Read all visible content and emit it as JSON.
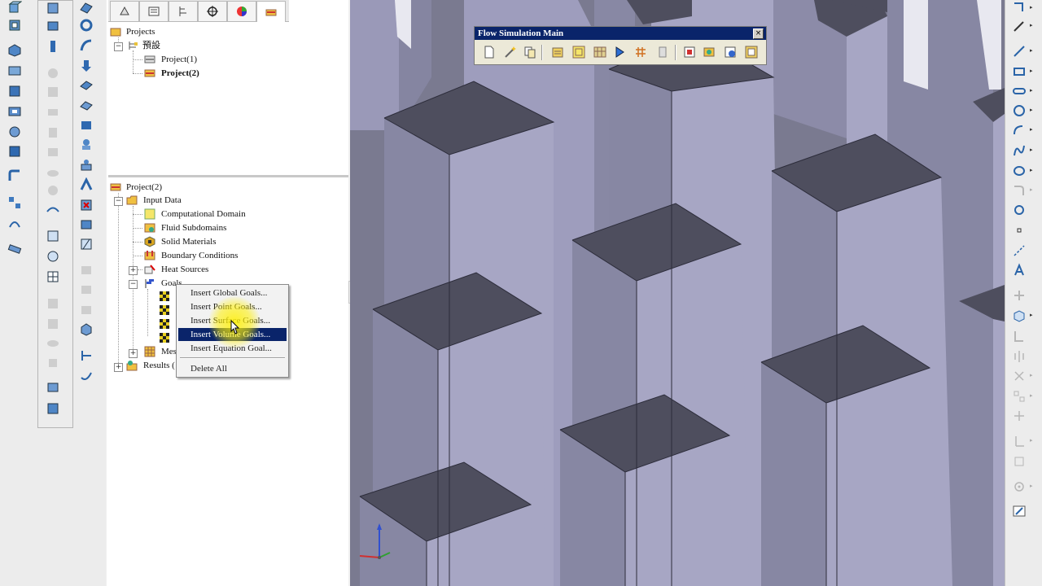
{
  "feature_tree": {
    "projects_root": "Projects",
    "config_name": "預設",
    "project1": "Project(1)",
    "project2": "Project(2)"
  },
  "analysis_tree": {
    "root": "Project(2)",
    "input_data": "Input Data",
    "computational_domain": "Computational Domain",
    "fluid_subdomains": "Fluid Subdomains",
    "solid_materials": "Solid Materials",
    "boundary_conditions": "Boundary Conditions",
    "heat_sources": "Heat Sources",
    "goals": "Goals",
    "mesh": "Mes",
    "results": "Results ("
  },
  "context_menu": {
    "items": [
      "Insert Global Goals...",
      "Insert Point Goals...",
      "Insert Surface Goals...",
      "Insert Volume Goals...",
      "Insert Equation Goal..."
    ],
    "highlighted_index": 3,
    "delete_all": "Delete All"
  },
  "flow_sim_toolbar": {
    "title": "Flow Simulation Main",
    "close": "×"
  },
  "colors": {
    "highlight": "#0a246a",
    "viewport_bg": "#7a7a90",
    "block_top": "#4e4e5e",
    "block_front": "#a7a6c4",
    "block_side": "#8787a3"
  },
  "icons": {
    "fm_tabs": [
      "feature-manager-icon",
      "property-manager-icon",
      "configuration-manager-icon",
      "dimxpert-icon",
      "display-manager-icon",
      "flow-simulation-analysis-tree-icon"
    ],
    "right_toolbar": [
      "line-icon",
      "rectangle-icon",
      "slot-icon",
      "circle-icon",
      "arc-icon",
      "spline-icon",
      "ellipse-icon",
      "fillet-icon",
      "polygon-icon",
      "point-icon",
      "centerline-icon",
      "text-icon",
      "trim-icon",
      "mirror-icon",
      "offset-icon",
      "relations-icon",
      "rapid-sketch-icon"
    ]
  }
}
